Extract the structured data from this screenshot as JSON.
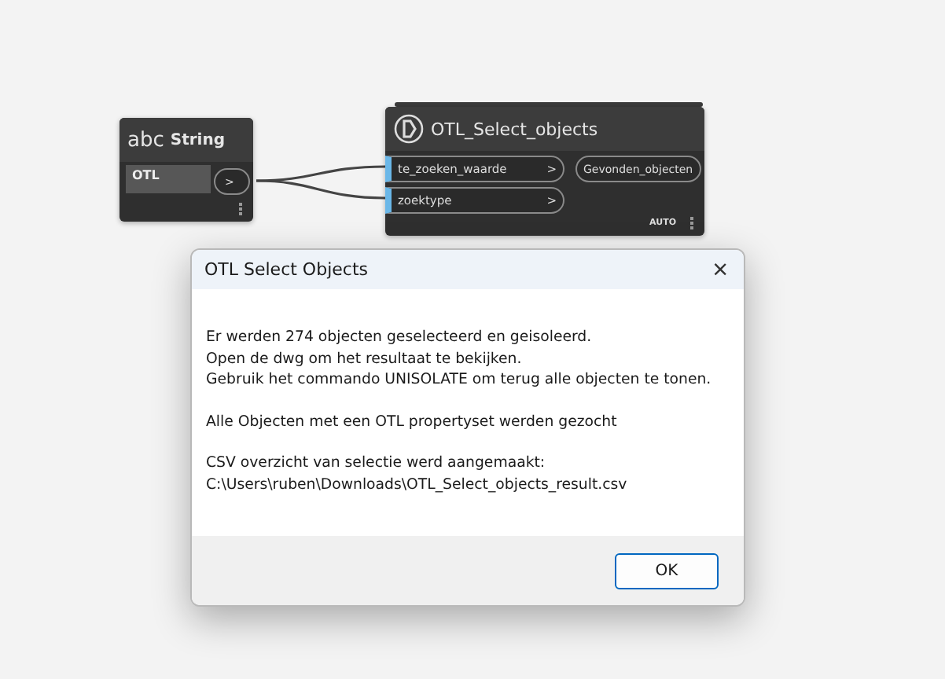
{
  "canvas": {
    "nodes": [
      {
        "kind": "input",
        "type_label": "abc",
        "title": "String",
        "value": "OTL",
        "output_port": ">"
      },
      {
        "kind": "function",
        "title": "OTL_Select_objects",
        "inputs": [
          {
            "label": "te_zoeken_waarde",
            "arrow": ">"
          },
          {
            "label": "zoektype",
            "arrow": ">"
          }
        ],
        "outputs": [
          "Gevonden_objecten"
        ],
        "run_mode": "AUTO"
      }
    ]
  },
  "dialog": {
    "title": "OTL Select Objects",
    "close": "×",
    "paragraphs": [
      [
        "Er werden 274 objecten geselecteerd en geisoleerd.",
        "Open de dwg om het resultaat te bekijken.",
        "Gebruik het commando UNISOLATE om terug alle objecten te tonen."
      ],
      [
        "Alle Objecten met een OTL propertyset werden gezocht"
      ],
      [
        "CSV overzicht van selectie werd aangemaakt:",
        "C:\\Users\\ruben\\Downloads\\OTL_Select_objects_result.csv"
      ]
    ],
    "buttons": [
      "OK"
    ]
  }
}
